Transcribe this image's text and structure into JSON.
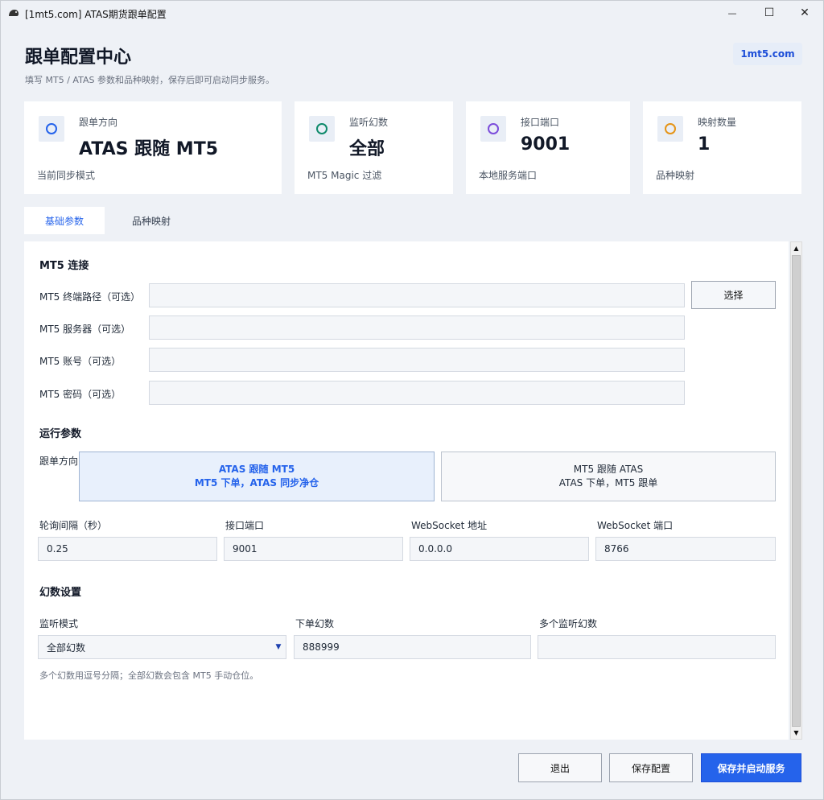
{
  "window": {
    "title": "[1mt5.com] ATAS期货跟单配置",
    "minimize": "—",
    "maximize": "☐",
    "close": "✕"
  },
  "header": {
    "title": "跟单配置中心",
    "subtitle": "填写 MT5 / ATAS 参数和品种映射，保存后即可启动同步服务。",
    "brand": "1mt5.com"
  },
  "stats": [
    {
      "label": "跟单方向",
      "value": "ATAS 跟随 MT5",
      "foot": "当前同步模式",
      "color": "#2563eb",
      "icon": "ring-blue-icon"
    },
    {
      "label": "监听幻数",
      "value": "全部",
      "foot": "MT5 Magic 过滤",
      "color": "#0f8a6b",
      "icon": "ring-green-icon"
    },
    {
      "label": "接口端口",
      "value": "9001",
      "foot": "本地服务端口",
      "color": "#7c4ddb",
      "icon": "ring-purple-icon"
    },
    {
      "label": "映射数量",
      "value": "1",
      "foot": "品种映射",
      "color": "#e59417",
      "icon": "ring-orange-icon"
    }
  ],
  "tabs": [
    {
      "label": "基础参数"
    },
    {
      "label": "品种映射"
    }
  ],
  "mt5": {
    "section": "MT5 连接",
    "path_label": "MT5 终端路径（可选）",
    "path_value": "",
    "browse": "选择",
    "server_label": "MT5 服务器（可选）",
    "server_value": "",
    "account_label": "MT5 账号（可选）",
    "account_value": "",
    "password_label": "MT5 密码（可选）",
    "password_value": ""
  },
  "runtime": {
    "section": "运行参数",
    "direction_label": "跟单方向",
    "direction_a_line1": "ATAS 跟随 MT5",
    "direction_a_line2": "MT5 下单，ATAS 同步净仓",
    "direction_b_line1": "MT5 跟随 ATAS",
    "direction_b_line2": "ATAS 下单，MT5 跟单",
    "poll_label": "轮询间隔（秒）",
    "poll_value": "0.25",
    "port_label": "接口端口",
    "port_value": "9001",
    "ws_addr_label": "WebSocket 地址",
    "ws_addr_value": "0.0.0.0",
    "ws_port_label": "WebSocket 端口",
    "ws_port_value": "8766"
  },
  "magic": {
    "section": "幻数设置",
    "mode_label": "监听模式",
    "mode_value": "全部幻数",
    "order_label": "下单幻数",
    "order_value": "888999",
    "multi_label": "多个监听幻数",
    "multi_value": "",
    "hint": "多个幻数用逗号分隔；全部幻数会包含 MT5 手动仓位。"
  },
  "footer": {
    "exit": "退出",
    "save": "保存配置",
    "save_start": "保存并启动服务"
  }
}
